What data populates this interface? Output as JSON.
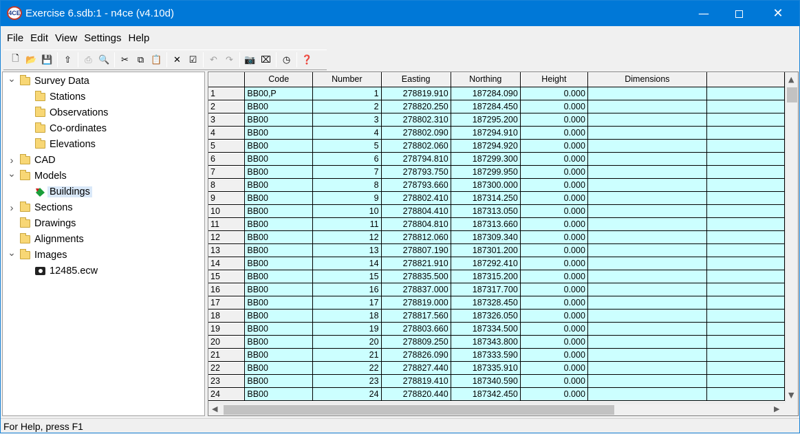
{
  "window": {
    "title": "Exercise 6.sdb:1 - n4ce (v4.10d)",
    "app_icon": "4CE",
    "accent_color": "#0078d7"
  },
  "menu": [
    "File",
    "Edit",
    "View",
    "Settings",
    "Help"
  ],
  "toolbar": [
    {
      "name": "new-icon",
      "glyph": "🗋",
      "enabled": true
    },
    {
      "name": "open-icon",
      "glyph": "📂",
      "enabled": true
    },
    {
      "name": "save-icon",
      "glyph": "💾",
      "enabled": true
    },
    {
      "name": "up-folder-icon",
      "glyph": "⇧",
      "enabled": true
    },
    {
      "name": "print-icon",
      "glyph": "⎙",
      "enabled": false
    },
    {
      "name": "print-preview-icon",
      "glyph": "🔍",
      "enabled": false
    },
    {
      "name": "cut-icon",
      "glyph": "✂",
      "enabled": true
    },
    {
      "name": "copy-icon",
      "glyph": "⧉",
      "enabled": true
    },
    {
      "name": "paste-icon",
      "glyph": "📋",
      "enabled": false
    },
    {
      "name": "delete-icon",
      "glyph": "✕",
      "enabled": true
    },
    {
      "name": "properties-icon",
      "glyph": "☑",
      "enabled": true
    },
    {
      "name": "undo-icon",
      "glyph": "↶",
      "enabled": false
    },
    {
      "name": "redo-icon",
      "glyph": "↷",
      "enabled": false
    },
    {
      "name": "camera-icon",
      "glyph": "📷",
      "enabled": true
    },
    {
      "name": "capture-icon",
      "glyph": "⌧",
      "enabled": true
    },
    {
      "name": "clock-icon",
      "glyph": "◷",
      "enabled": true
    },
    {
      "name": "help-icon",
      "glyph": "❓",
      "enabled": true
    }
  ],
  "tree": [
    {
      "label": "Survey Data",
      "level": 0,
      "expander": "expanded",
      "icon": "folder-icon"
    },
    {
      "label": "Stations",
      "level": 1,
      "expander": "none",
      "icon": "folder-icon"
    },
    {
      "label": "Observations",
      "level": 1,
      "expander": "none",
      "icon": "folder-icon"
    },
    {
      "label": "Co-ordinates",
      "level": 1,
      "expander": "none",
      "icon": "folder-icon"
    },
    {
      "label": "Elevations",
      "level": 1,
      "expander": "none",
      "icon": "folder-icon"
    },
    {
      "label": "CAD",
      "level": 0,
      "expander": "collapsed",
      "icon": "folder-icon"
    },
    {
      "label": "Models",
      "level": 0,
      "expander": "expanded",
      "icon": "folder-icon"
    },
    {
      "label": "Buildings",
      "level": 1,
      "expander": "none",
      "icon": "model-icon",
      "selected": true
    },
    {
      "label": "Sections",
      "level": 0,
      "expander": "collapsed",
      "icon": "folder-icon"
    },
    {
      "label": "Drawings",
      "level": 0,
      "expander": "none",
      "icon": "folder-icon"
    },
    {
      "label": "Alignments",
      "level": 0,
      "expander": "none",
      "icon": "folder-icon"
    },
    {
      "label": "Images",
      "level": 0,
      "expander": "expanded",
      "icon": "folder-icon"
    },
    {
      "label": "12485.ecw",
      "level": 1,
      "expander": "none",
      "icon": "camera-icon"
    }
  ],
  "grid": {
    "columns": [
      "Code",
      "Number",
      "Easting",
      "Northing",
      "Height",
      "Dimensions"
    ],
    "cell_color": "#ccffff",
    "rows": [
      [
        "1",
        "BB00,P",
        "1",
        "278819.910",
        "187284.090",
        "0.000",
        ""
      ],
      [
        "2",
        "BB00",
        "2",
        "278820.250",
        "187284.450",
        "0.000",
        ""
      ],
      [
        "3",
        "BB00",
        "3",
        "278802.310",
        "187295.200",
        "0.000",
        ""
      ],
      [
        "4",
        "BB00",
        "4",
        "278802.090",
        "187294.910",
        "0.000",
        ""
      ],
      [
        "5",
        "BB00",
        "5",
        "278802.060",
        "187294.920",
        "0.000",
        ""
      ],
      [
        "6",
        "BB00",
        "6",
        "278794.810",
        "187299.300",
        "0.000",
        ""
      ],
      [
        "7",
        "BB00",
        "7",
        "278793.750",
        "187299.950",
        "0.000",
        ""
      ],
      [
        "8",
        "BB00",
        "8",
        "278793.660",
        "187300.000",
        "0.000",
        ""
      ],
      [
        "9",
        "BB00",
        "9",
        "278802.410",
        "187314.250",
        "0.000",
        ""
      ],
      [
        "10",
        "BB00",
        "10",
        "278804.410",
        "187313.050",
        "0.000",
        ""
      ],
      [
        "11",
        "BB00",
        "11",
        "278804.810",
        "187313.660",
        "0.000",
        ""
      ],
      [
        "12",
        "BB00",
        "12",
        "278812.060",
        "187309.340",
        "0.000",
        ""
      ],
      [
        "13",
        "BB00",
        "13",
        "278807.190",
        "187301.200",
        "0.000",
        ""
      ],
      [
        "14",
        "BB00",
        "14",
        "278821.910",
        "187292.410",
        "0.000",
        ""
      ],
      [
        "15",
        "BB00",
        "15",
        "278835.500",
        "187315.200",
        "0.000",
        ""
      ],
      [
        "16",
        "BB00",
        "16",
        "278837.000",
        "187317.700",
        "0.000",
        ""
      ],
      [
        "17",
        "BB00",
        "17",
        "278819.000",
        "187328.450",
        "0.000",
        ""
      ],
      [
        "18",
        "BB00",
        "18",
        "278817.560",
        "187326.050",
        "0.000",
        ""
      ],
      [
        "19",
        "BB00",
        "19",
        "278803.660",
        "187334.500",
        "0.000",
        ""
      ],
      [
        "20",
        "BB00",
        "20",
        "278809.250",
        "187343.800",
        "0.000",
        ""
      ],
      [
        "21",
        "BB00",
        "21",
        "278826.090",
        "187333.590",
        "0.000",
        ""
      ],
      [
        "22",
        "BB00",
        "22",
        "278827.440",
        "187335.910",
        "0.000",
        ""
      ],
      [
        "23",
        "BB00",
        "23",
        "278819.410",
        "187340.590",
        "0.000",
        ""
      ],
      [
        "24",
        "BB00",
        "24",
        "278820.440",
        "187342.450",
        "0.000",
        ""
      ]
    ]
  },
  "status": "For Help, press F1"
}
